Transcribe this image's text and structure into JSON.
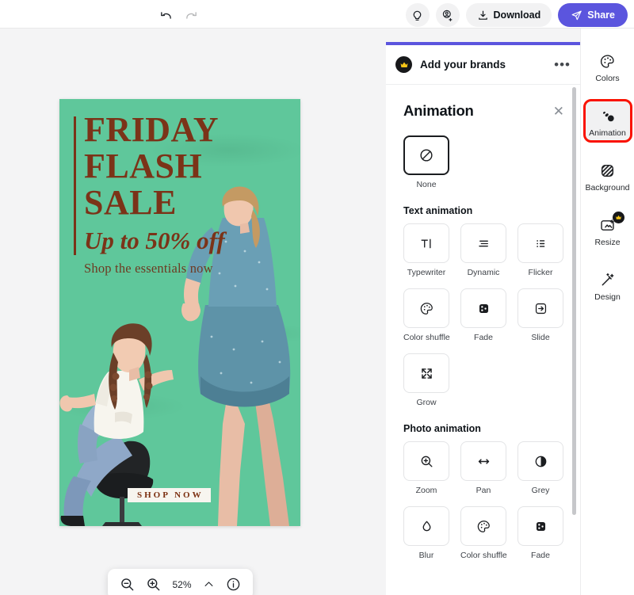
{
  "topbar": {
    "undo": {
      "label": "Undo",
      "icon": "undo-icon"
    },
    "redo": {
      "label": "Redo",
      "icon": "redo-icon"
    },
    "tips": {
      "label": "Tips",
      "icon": "lightbulb-icon"
    },
    "invite": {
      "label": "Invite members",
      "icon": "person-add-icon"
    },
    "download": {
      "label": "Download",
      "icon": "download-icon"
    },
    "share": {
      "label": "Share",
      "icon": "send-icon"
    },
    "share_color": "#5b55de"
  },
  "canvas": {
    "poster": {
      "background_color": "#5fc79b",
      "text_color": "#7b3318",
      "headline_line1": "FRIDAY",
      "headline_line2": "FLASH",
      "headline_line3": "SALE",
      "subheadline": "Up to 50% off",
      "tagline": "Shop the essentials now",
      "cta_label": "SHOP NOW",
      "cta_bg": "#f7f5ef",
      "cta_text_color": "#7b2f10"
    }
  },
  "zoombar": {
    "zoom_out": "zoom-out-icon",
    "zoom_in": "zoom-in-icon",
    "zoom_value": "52%",
    "expand": "chevron-up-icon",
    "info": "info-icon"
  },
  "panel": {
    "accent_color": "#5b55de",
    "brand_row": {
      "badge_icon": "crown-icon",
      "title": "Add your brands",
      "more": "more-options-icon"
    },
    "title": "Animation",
    "close_icon": "close-icon",
    "none": {
      "label": "None",
      "icon": "no-animation-icon"
    },
    "sections": [
      {
        "label": "Text animation",
        "items": [
          {
            "label": "Typewriter",
            "icon": "typewriter-icon"
          },
          {
            "label": "Dynamic",
            "icon": "dynamic-icon"
          },
          {
            "label": "Flicker",
            "icon": "flicker-icon"
          },
          {
            "label": "Color shuffle",
            "icon": "color-shuffle-icon"
          },
          {
            "label": "Fade",
            "icon": "fade-icon"
          },
          {
            "label": "Slide",
            "icon": "slide-icon"
          },
          {
            "label": "Grow",
            "icon": "grow-icon"
          }
        ]
      },
      {
        "label": "Photo animation",
        "items": [
          {
            "label": "Zoom",
            "icon": "zoom-in-icon"
          },
          {
            "label": "Pan",
            "icon": "pan-arrows-icon"
          },
          {
            "label": "Grey",
            "icon": "contrast-circle-icon"
          },
          {
            "label": "Blur",
            "icon": "droplet-icon"
          },
          {
            "label": "Color shuffle",
            "icon": "palette-icon"
          },
          {
            "label": "Fade",
            "icon": "fade-icon"
          }
        ]
      }
    ]
  },
  "rail": {
    "highlight_color": "#fa1200",
    "items": [
      {
        "label": "Colors",
        "icon": "palette-icon",
        "active": false,
        "highlighted": false,
        "pro": false
      },
      {
        "label": "Animation",
        "icon": "animation-icon",
        "active": true,
        "highlighted": true,
        "pro": false
      },
      {
        "label": "Background",
        "icon": "background-icon",
        "active": false,
        "highlighted": false,
        "pro": false
      },
      {
        "label": "Resize",
        "icon": "resize-icon",
        "active": false,
        "highlighted": false,
        "pro": true
      },
      {
        "label": "Design",
        "icon": "magic-wand-icon",
        "active": false,
        "highlighted": false,
        "pro": false
      }
    ]
  }
}
